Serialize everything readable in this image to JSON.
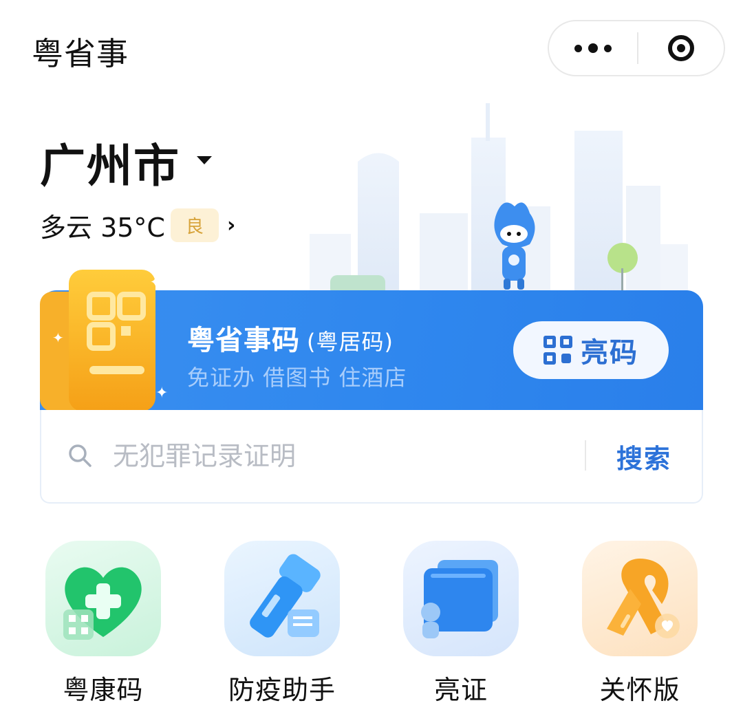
{
  "app": {
    "title": "粤省事"
  },
  "capsule": {
    "more_icon": "more-dots-icon",
    "close_icon": "close-circle-icon"
  },
  "location": {
    "city": "广州市",
    "weather": "多云 35°C",
    "aqi": "良"
  },
  "code_card": {
    "title": "粤省事码",
    "subtitle": "(粤居码)",
    "description": "免证办 借图书 住酒店",
    "button_label": "亮码"
  },
  "search": {
    "placeholder": "无犯罪记录证明",
    "button_label": "搜索"
  },
  "services": [
    {
      "label": "粤康码",
      "icon": "green-heart-health-code-icon"
    },
    {
      "label": "防疫助手",
      "icon": "blue-flashlight-icon"
    },
    {
      "label": "亮证",
      "icon": "blue-wallet-card-icon"
    },
    {
      "label": "关怀版",
      "icon": "orange-ribbon-icon"
    }
  ],
  "colors": {
    "accent": "#2f87ee",
    "search": "#2c72d9",
    "aqi_bg": "#fdf1d6",
    "aqi_text": "#d7a33a"
  }
}
